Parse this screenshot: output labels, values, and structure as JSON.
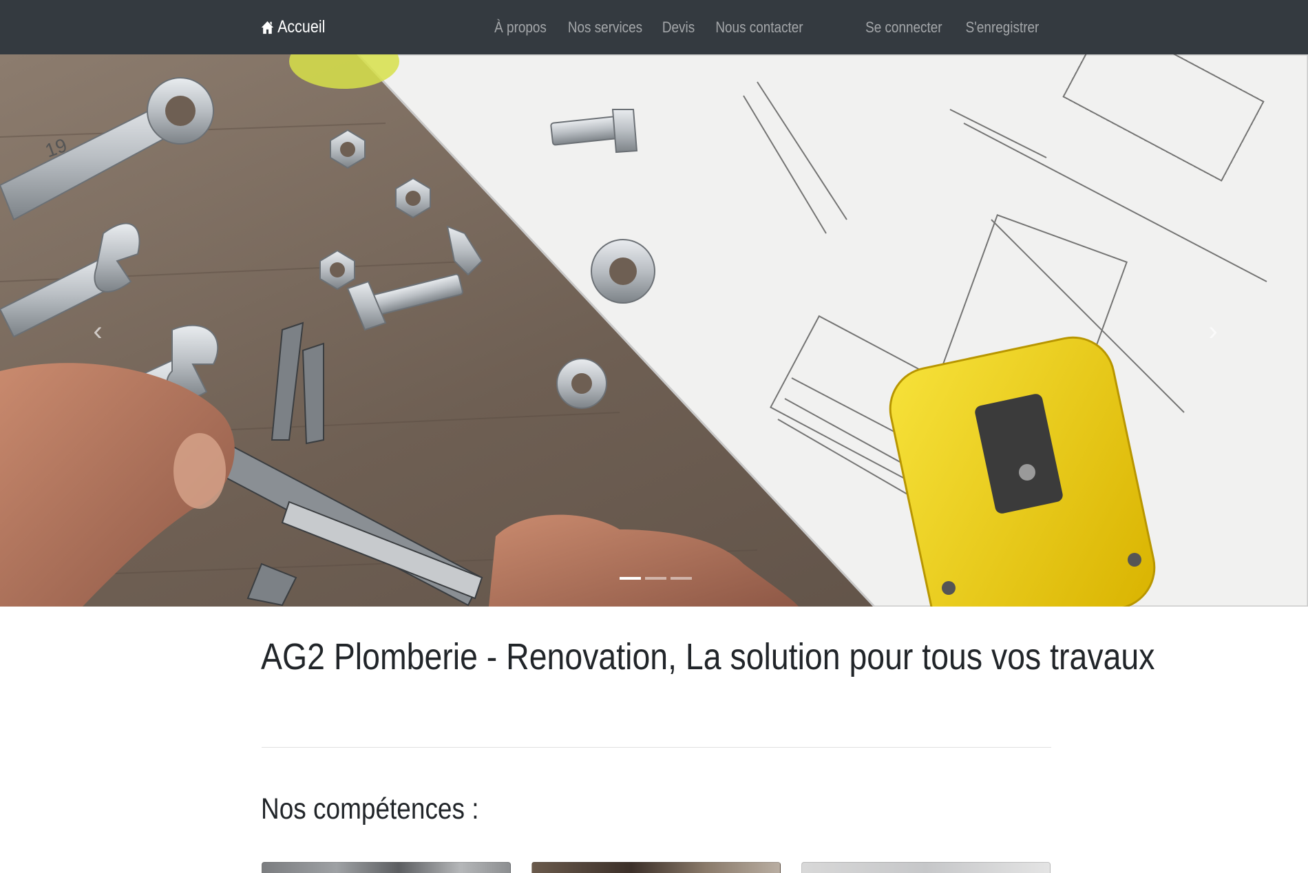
{
  "navbar": {
    "brand": {
      "label": "Accueil",
      "icon": "home-icon"
    },
    "center_links": [
      {
        "label": "À propos"
      },
      {
        "label": "Nos services"
      },
      {
        "label": "Devis"
      },
      {
        "label": "Nous contacter"
      }
    ],
    "right_links": [
      {
        "label": "Se connecter"
      },
      {
        "label": "S'enregistrer"
      }
    ],
    "background_color": "#343a40"
  },
  "carousel": {
    "slide_count": 3,
    "active_slide": 1,
    "prev_icon": "chevron-left-icon",
    "next_icon": "chevron-right-icon",
    "prev_glyph": "‹",
    "next_glyph": "›"
  },
  "main": {
    "title": "AG2 Plomberie - Renovation, La solution pour tous vos travaux",
    "section_title": "Nos compétences :"
  }
}
